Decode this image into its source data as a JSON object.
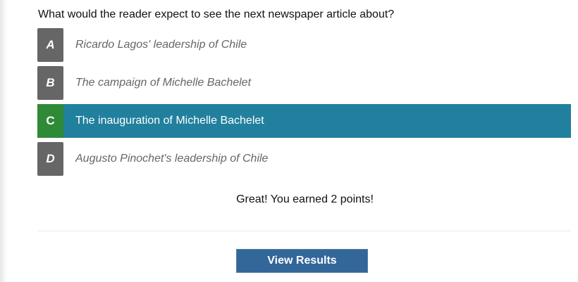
{
  "question": "What would the reader expect to see the next newspaper article about?",
  "options": [
    {
      "letter": "A",
      "text": "Ricardo Lagos' leadership of Chile"
    },
    {
      "letter": "B",
      "text": "The campaign of Michelle Bachelet"
    },
    {
      "letter": "C",
      "text": "The inauguration of Michelle Bachelet",
      "selected": true
    },
    {
      "letter": "D",
      "text": "Augusto Pinochet's leadership of Chile"
    }
  ],
  "feedback": "Great! You earned 2 points!",
  "view_results_label": "View Results",
  "colors": {
    "selected_bg": "#21809d",
    "correct_letter_bg": "#2e8a36",
    "letter_bg": "#666666",
    "button_bg": "#336699"
  }
}
